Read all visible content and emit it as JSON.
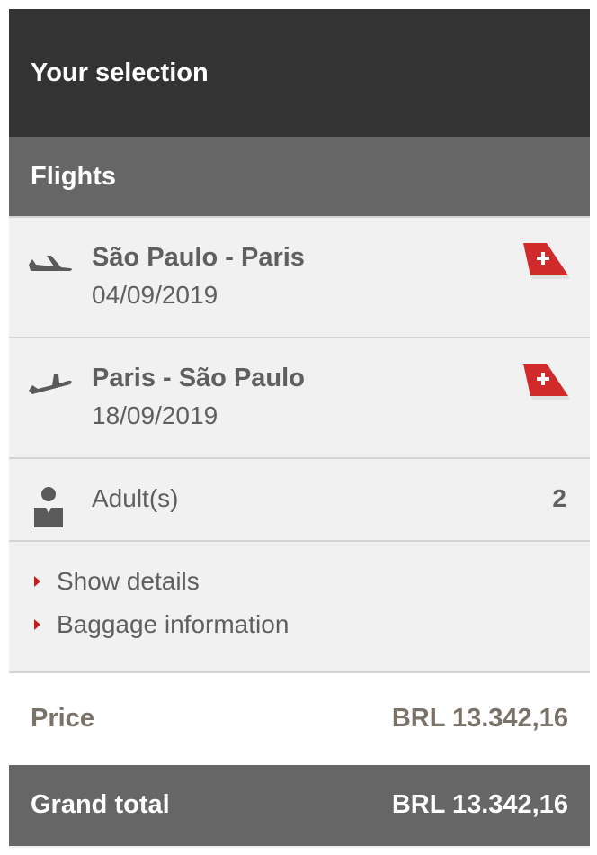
{
  "header": {
    "title": "Your selection"
  },
  "section": {
    "title": "Flights"
  },
  "flights": [
    {
      "route": "São Paulo - Paris",
      "date": "04/09/2019",
      "icon": "plane-takeoff-icon",
      "airline_icon": "swiss-tail-icon"
    },
    {
      "route": "Paris - São Paulo",
      "date": "18/09/2019",
      "icon": "plane-landing-icon",
      "airline_icon": "swiss-tail-icon"
    }
  ],
  "passengers": {
    "label": "Adult(s)",
    "count": "2"
  },
  "links": [
    {
      "label": "Show details"
    },
    {
      "label": "Baggage information"
    }
  ],
  "price": {
    "label": "Price",
    "value": "BRL 13.342,16"
  },
  "total": {
    "label": "Grand total",
    "value": "BRL 13.342,16"
  },
  "colors": {
    "header_bg": "#333333",
    "section_bg": "#666666",
    "panel_bg": "#f1f1f1",
    "accent_red": "#c61c1c",
    "text": "#5f5f5f"
  }
}
